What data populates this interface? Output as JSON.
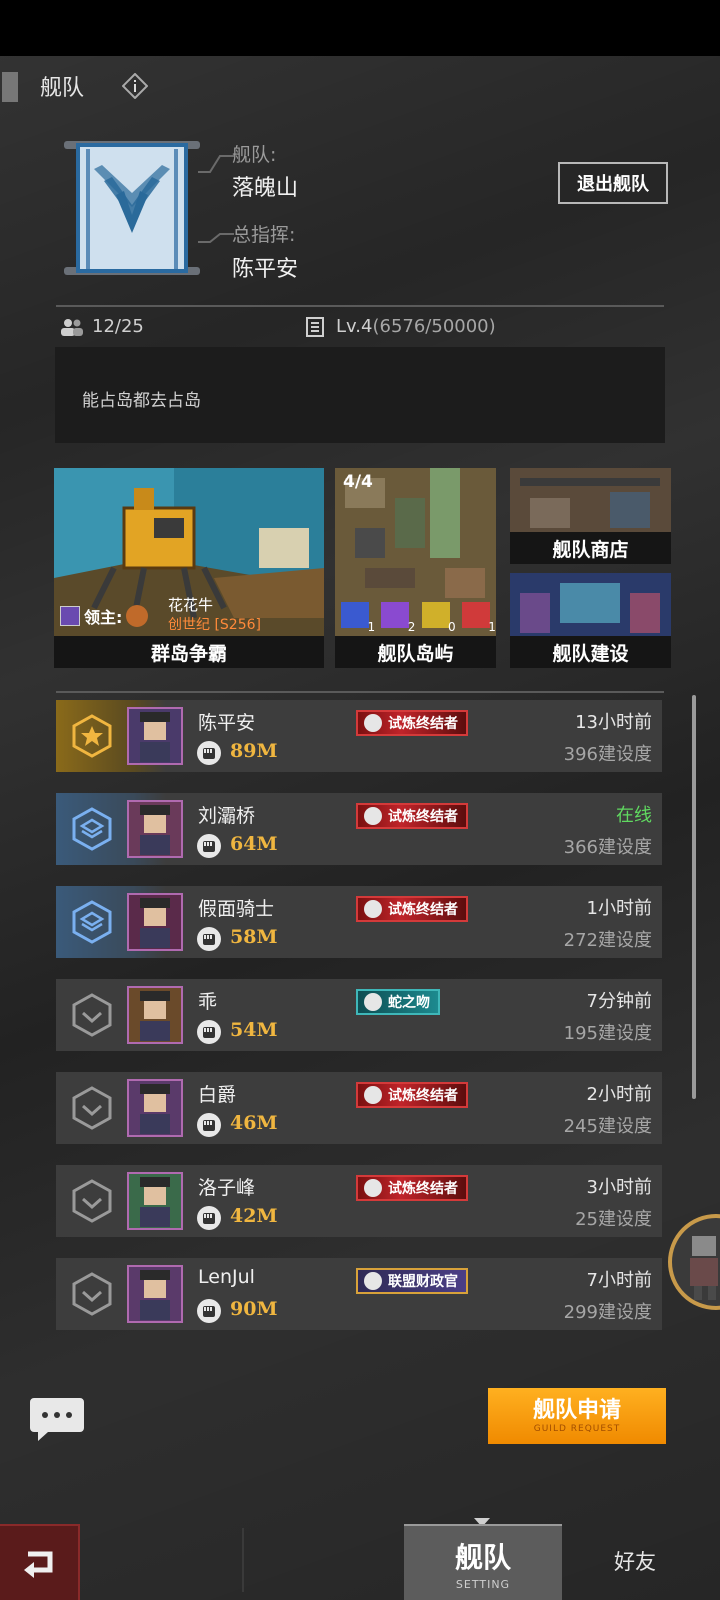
{
  "header": {
    "title": "舰队",
    "info_icon": "info-icon"
  },
  "fleet": {
    "fleet_label": "舰队:",
    "fleet_name": "落魄山",
    "commander_label": "总指挥:",
    "commander_name": "陈平安",
    "quit_label": "退出舰队",
    "members": "12/25",
    "level": "Lv.4",
    "exp": "(6576/50000)",
    "notice": "能占岛都去占岛"
  },
  "tiles": {
    "island_war": {
      "caption": "群岛争霸",
      "lord_label": "领主:",
      "lord_name": "花花牛",
      "lord_server": "创世纪 [S256]"
    },
    "fleet_islands": {
      "caption": "舰队岛屿",
      "progress": "4/4",
      "counts": [
        "1",
        "2",
        "0",
        "1"
      ]
    },
    "shop": {
      "caption": "舰队商店"
    },
    "build": {
      "caption": "舰队建设"
    }
  },
  "members": [
    {
      "name": "陈平安",
      "power": "89M",
      "title": "试炼终结者",
      "badge": "red",
      "time": "13小时前",
      "build": "396建设度",
      "rank": "leader",
      "online": false
    },
    {
      "name": "刘灞桥",
      "power": "64M",
      "title": "试炼终结者",
      "badge": "red",
      "time": "在线",
      "build": "366建设度",
      "rank": "officer",
      "online": true
    },
    {
      "name": "假面骑士",
      "power": "58M",
      "title": "试炼终结者",
      "badge": "red",
      "time": "1小时前",
      "build": "272建设度",
      "rank": "officer",
      "online": false
    },
    {
      "name": "乖",
      "power": "54M",
      "title": "蛇之吻",
      "badge": "teal",
      "time": "7分钟前",
      "build": "195建设度",
      "rank": "member",
      "online": false
    },
    {
      "name": "白爵",
      "power": "46M",
      "title": "试炼终结者",
      "badge": "red",
      "time": "2小时前",
      "build": "245建设度",
      "rank": "member",
      "online": false
    },
    {
      "name": "洛子峰",
      "power": "42M",
      "title": "试炼终结者",
      "badge": "red",
      "time": "3小时前",
      "build": "25建设度",
      "rank": "member",
      "online": false
    },
    {
      "name": "LenJul",
      "power": "90M",
      "title": "联盟财政官",
      "badge": "gold",
      "time": "7小时前",
      "build": "299建设度",
      "rank": "member",
      "online": false
    }
  ],
  "apply": {
    "label": "舰队申请",
    "sub": "GUILD REQUEST"
  },
  "nav": {
    "fleet_label": "舰队",
    "fleet_sub": "SETTING",
    "friends_label": "好友"
  },
  "colors": {
    "accent_orange": "#f59a10",
    "power_gold": "#f0b640",
    "online_green": "#60d860",
    "title_red": "#c0242a"
  }
}
